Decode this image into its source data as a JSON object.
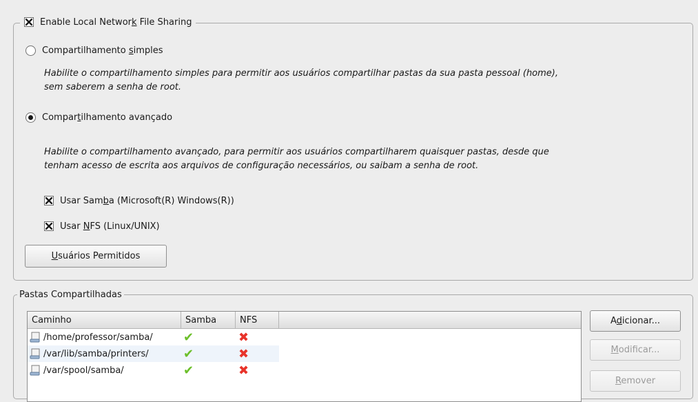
{
  "sharing": {
    "enable_pre": "Enable Local Networ",
    "enable_mn": "k",
    "enable_post": " File Sharing",
    "simple_pre": "Compartilhamento ",
    "simple_mn": "s",
    "simple_post": "imples",
    "simple_desc_1": "Habilite o compartilhamento simples para permitir aos usuários compartilhar pastas da sua pasta pessoal (home),",
    "simple_desc_2": "sem saberem a senha de root.",
    "advanced_pre": "Compar",
    "advanced_mn": "t",
    "advanced_post": "ilhamento avançado",
    "advanced_desc_1": "Habilite o compartilhamento avançado, para permitir aos usuários compartilharem quaisquer pastas, desde que",
    "advanced_desc_2": "tenham acesso de escrita aos arquivos de configuração necessários, ou saibam a senha de root.",
    "samba_pre": "Usar Sam",
    "samba_mn": "b",
    "samba_post": "a (Microsoft(R) Windows(R))",
    "nfs_pre": "Usar ",
    "nfs_mn": "N",
    "nfs_post": "FS (Linux/UNIX)",
    "users_mn": "U",
    "users_post": "suários Permitidos"
  },
  "shares": {
    "legend": "Pastas Compartilhadas",
    "columns": [
      "Caminho",
      "Samba",
      "NFS"
    ],
    "rows": [
      {
        "path": "/home/professor/samba/",
        "samba": "✔",
        "nfs": "✖"
      },
      {
        "path": "/var/lib/samba/printers/",
        "samba": "✔",
        "nfs": "✖"
      },
      {
        "path": "/var/spool/samba/",
        "samba": "✔",
        "nfs": "✖"
      }
    ],
    "add_pre": "A",
    "add_mn": "d",
    "add_post": "icionar...",
    "modify_mn": "M",
    "modify_post": "odificar...",
    "remove_mn": "R",
    "remove_post": "emover"
  },
  "colors": {
    "check": "#6cbf2a",
    "cross": "#e8332a"
  }
}
